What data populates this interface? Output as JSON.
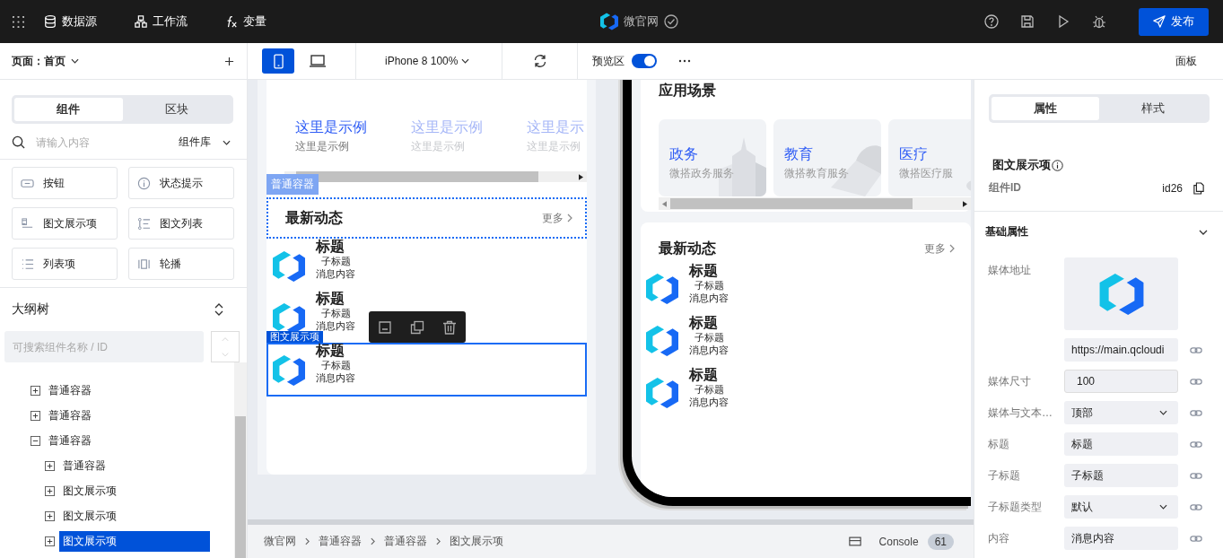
{
  "topbar": {
    "menu": [
      {
        "kind": "database",
        "label": "数据源"
      },
      {
        "kind": "flow",
        "label": "工作流"
      },
      {
        "kind": "fx",
        "label": "变量"
      }
    ],
    "app_title": "微官网",
    "publish": "发布"
  },
  "toolbar": {
    "page_label": "页面：首页",
    "devices": [
      {
        "kind": "phone",
        "selected": true
      },
      {
        "kind": "desktop",
        "selected": false
      }
    ],
    "zoom": "iPhone 8 100%",
    "preview_label": "预览区",
    "preview_on": true,
    "panel": "面板"
  },
  "left_panel": {
    "tabs": [
      {
        "label": "组件",
        "selected": true
      },
      {
        "label": "区块",
        "selected": false
      }
    ],
    "search_placeholder": "请输入内容",
    "library": "组件库",
    "components": [
      {
        "kind": "button",
        "label": "按钮"
      },
      {
        "kind": "info",
        "label": "状态提示"
      },
      {
        "kind": "media",
        "label": "图文展示项"
      },
      {
        "kind": "medialist",
        "label": "图文列表"
      },
      {
        "kind": "list",
        "label": "列表项"
      },
      {
        "kind": "carousel",
        "label": "轮播"
      }
    ],
    "outline_title": "大纲树",
    "outline_search_placeholder": "可搜索组件名称 / ID",
    "tree": [
      {
        "label": "普通容器",
        "expanded": false,
        "selected": false
      },
      {
        "label": "普通容器",
        "expanded": false,
        "selected": false
      },
      {
        "label": "普通容器",
        "expanded": true,
        "selected": false,
        "children": [
          {
            "label": "普通容器",
            "expanded": false,
            "selected": false
          },
          {
            "label": "图文展示项",
            "expanded": false,
            "selected": false
          },
          {
            "label": "图文展示项",
            "expanded": false,
            "selected": false
          },
          {
            "label": "图文展示项",
            "expanded": false,
            "selected": true
          }
        ]
      }
    ]
  },
  "design_canvas": {
    "carousel": [
      {
        "title": "这里是示例",
        "subtitle": "这里是示例",
        "active": true
      },
      {
        "title": "这里是示例",
        "subtitle": "这里是示例",
        "active": false
      },
      {
        "title": "这里是示",
        "subtitle": "这里是示例",
        "active": false
      }
    ],
    "container_tag": "普通容器",
    "section_title": "最新动态",
    "more": "更多",
    "selected_tag": "图文展示项",
    "items": [
      {
        "title": "标题",
        "subtitle": "子标题",
        "content": "消息内容",
        "selected": false
      },
      {
        "title": "标题",
        "subtitle": "子标题",
        "content": "消息内容",
        "selected": false
      },
      {
        "title": "标题",
        "subtitle": "子标题",
        "content": "消息内容",
        "selected": true
      }
    ]
  },
  "phone_preview": {
    "scenes_title": "应用场景",
    "scenes": [
      {
        "kind": "building",
        "title": "政务",
        "subtitle": "微搭政务服务"
      },
      {
        "kind": "book",
        "title": "教育",
        "subtitle": "微搭教育服务"
      },
      {
        "kind": "pills",
        "title": "医疗",
        "subtitle": "微搭医疗服"
      }
    ],
    "section_title": "最新动态",
    "more": "更多",
    "items": [
      {
        "title": "标题",
        "subtitle": "子标题",
        "content": "消息内容"
      },
      {
        "title": "标题",
        "subtitle": "子标题",
        "content": "消息内容"
      },
      {
        "title": "标题",
        "subtitle": "子标题",
        "content": "消息内容"
      }
    ]
  },
  "status_bar": {
    "breadcrumb": [
      "微官网",
      "普通容器",
      "普通容器",
      "图文展示项"
    ],
    "console": "Console",
    "console_count": "61"
  },
  "right_panel": {
    "tabs": [
      {
        "label": "属性",
        "selected": true
      },
      {
        "label": "样式",
        "selected": false
      }
    ],
    "component_name": "图文展示项",
    "id_label": "组件ID",
    "id_value": "id26",
    "section": "基础属性",
    "section_expanded": true,
    "fields": [
      {
        "label": "媒体地址",
        "kind": "image",
        "value": "https://main.qcloudi"
      },
      {
        "label": "媒体尺寸",
        "kind": "number",
        "value": "100"
      },
      {
        "label": "媒体与文本…",
        "kind": "select",
        "value": "顶部"
      },
      {
        "label": "标题",
        "kind": "text",
        "value": "标题"
      },
      {
        "label": "子标题",
        "kind": "text",
        "value": "子标题"
      },
      {
        "label": "子标题类型",
        "kind": "select",
        "value": "默认"
      },
      {
        "label": "内容",
        "kind": "text",
        "value": "消息内容"
      }
    ]
  }
}
